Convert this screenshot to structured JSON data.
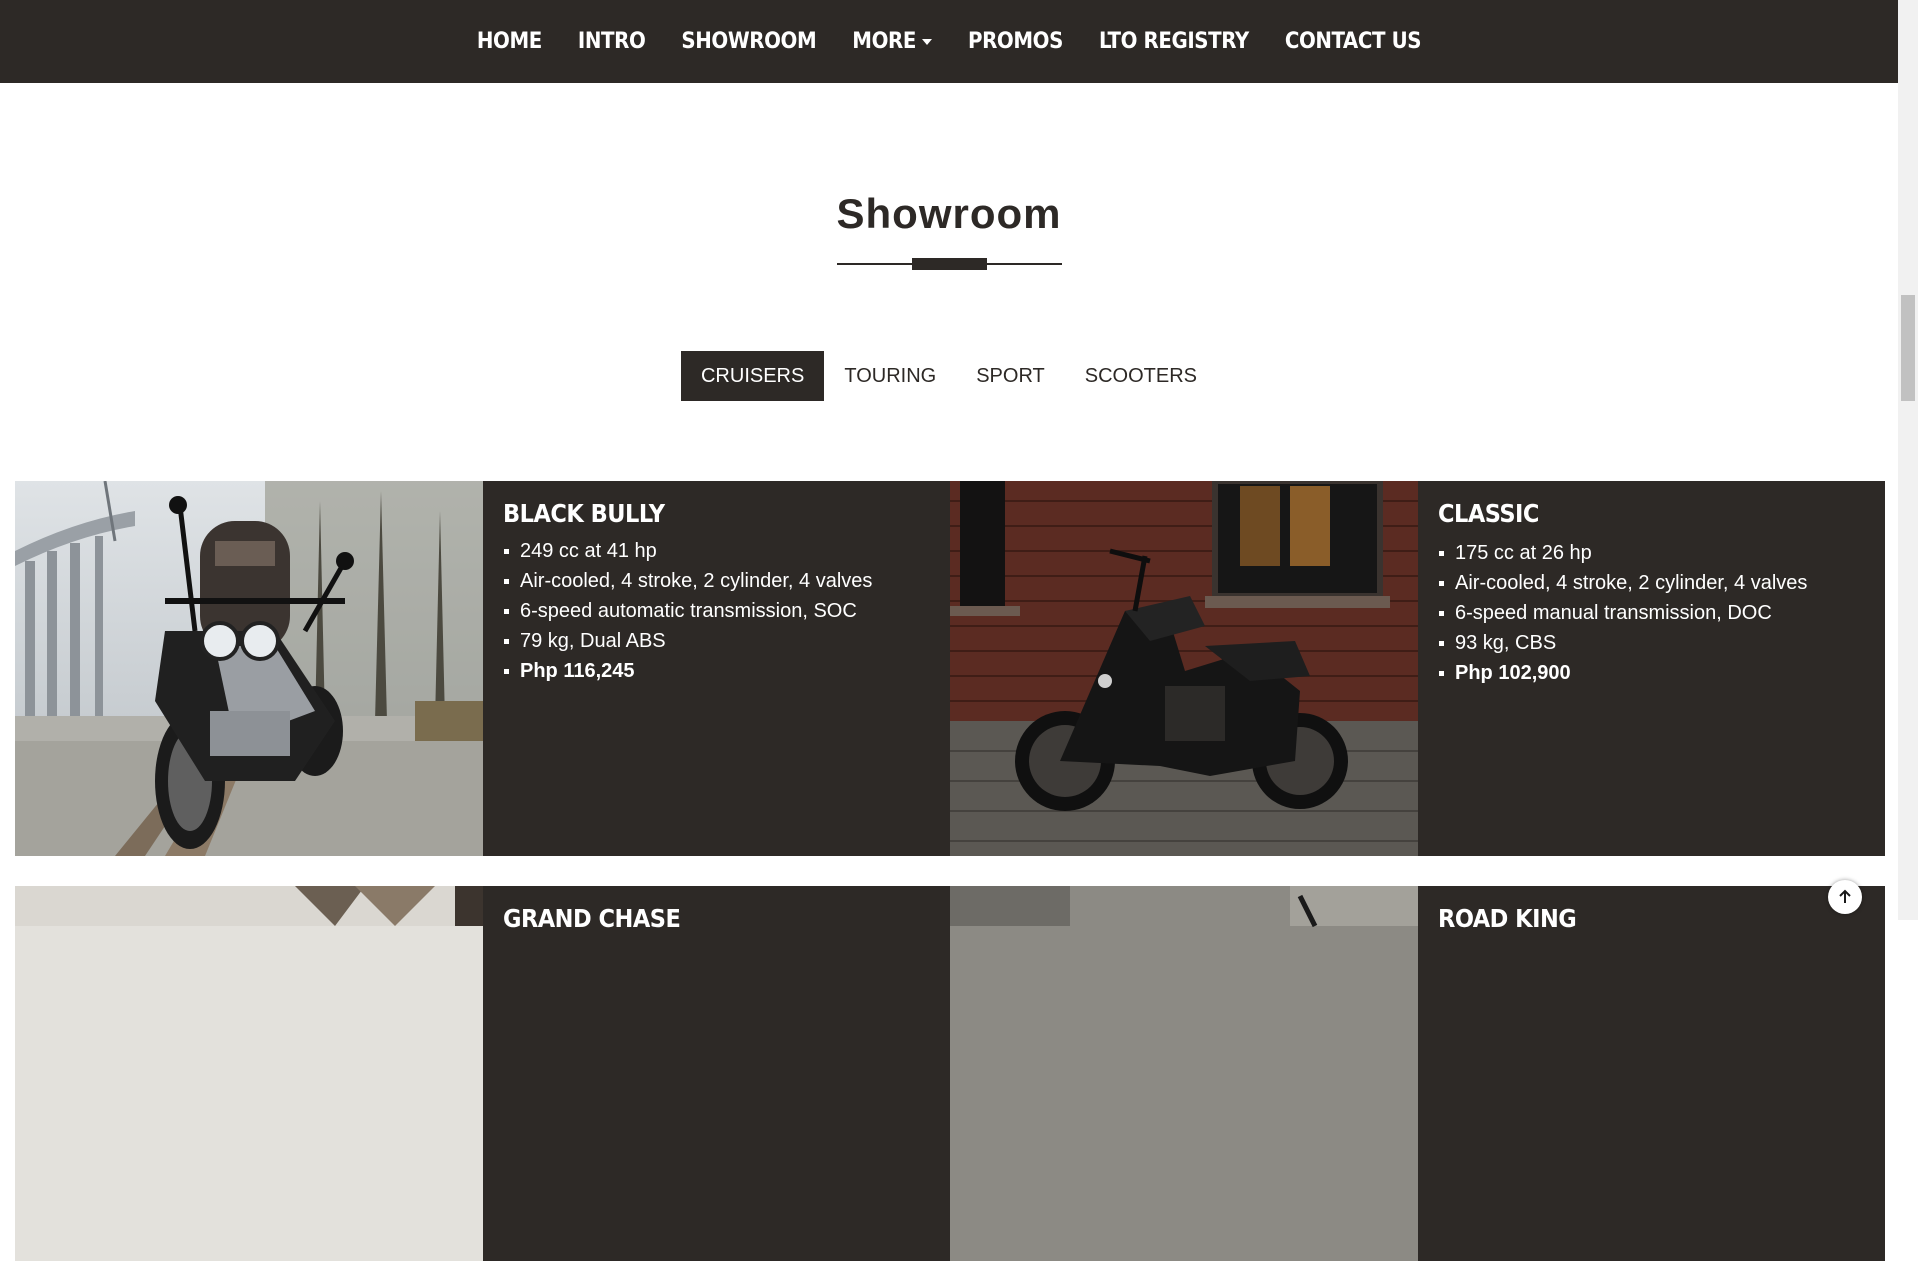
{
  "nav": {
    "items": [
      {
        "label": "HOME"
      },
      {
        "label": "INTRO"
      },
      {
        "label": "SHOWROOM"
      },
      {
        "label": "MORE"
      },
      {
        "label": "PROMOS"
      },
      {
        "label": "LTO REGISTRY"
      },
      {
        "label": "CONTACT US"
      }
    ]
  },
  "showroom": {
    "title": "Showroom",
    "tabs": [
      {
        "label": "CRUISERS",
        "active": true
      },
      {
        "label": "TOURING"
      },
      {
        "label": "SPORT"
      },
      {
        "label": "SCOOTERS"
      }
    ]
  },
  "cards": [
    {
      "name": "BLACK BULLY",
      "specs": [
        "249 cc at 41 hp",
        "Air-cooled, 4 stroke, 2 cylinder, 4 valves",
        "6-speed automatic transmission, SOC",
        "79 kg, Dual ABS"
      ],
      "price": "Php 116,245"
    },
    {
      "name": "CLASSIC",
      "specs": [
        "175 cc at 26 hp",
        "Air-cooled, 4 stroke, 2 cylinder, 4 valves",
        "6-speed manual transmission, DOC",
        "93 kg, CBS"
      ],
      "price": "Php 102,900"
    },
    {
      "name": "GRAND CHASE"
    },
    {
      "name": "ROAD KING"
    }
  ],
  "colors": {
    "dark": "#2d2926",
    "white": "#ffffff"
  },
  "icons": {
    "back_to_top": "arrow-up-icon",
    "dropdown": "caret-down-icon"
  }
}
